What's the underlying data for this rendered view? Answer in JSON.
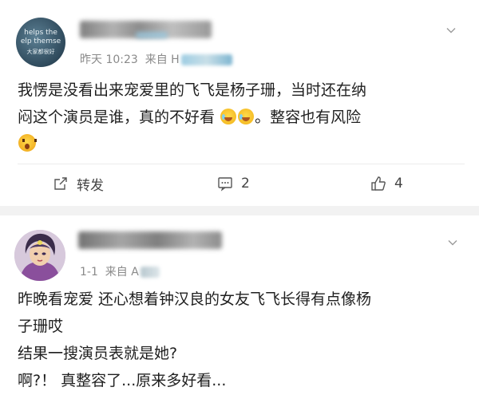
{
  "posts": [
    {
      "avatar_text": [
        "helps the",
        "elp themse",
        "大家都很好"
      ],
      "meta_time": "昨天 10:23",
      "meta_from": "来自 H",
      "content_lines": [
        "我愣是没看出来宠爱里的飞飞是杨子珊，当时还在纳",
        "闷这个演员是谁，真的不好看",
        "。整容也有风险"
      ],
      "actions": {
        "share_label": "转发",
        "comment_count": "2",
        "like_count": "4"
      }
    },
    {
      "meta_time": "1-1",
      "meta_from": "来自 A",
      "content_lines": [
        "昨晚看宠爱 还心想着钟汉良的女友飞飞长得有点像杨",
        "子珊哎",
        "结果一搜演员表就是她?",
        "啊?！ 真整容了...原来多好看..."
      ]
    }
  ],
  "icons": {
    "emoji_laugh_cry": "laugh-cry-emoji",
    "emoji_shock": "shocked-emoji",
    "share": "share-icon",
    "comment": "comment-icon",
    "like": "thumbs-up-icon",
    "more": "chevron-down-icon"
  },
  "colors": {
    "text": "#1f1f1f",
    "meta": "#8a8a8a",
    "separator": "#f2f2f2"
  }
}
